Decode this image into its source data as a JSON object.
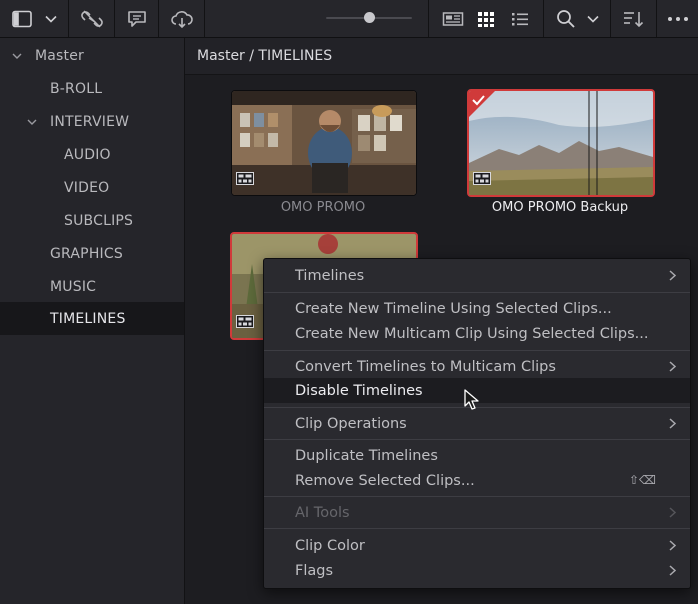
{
  "toolbar": {
    "icons": [
      "panel-layout-icon",
      "chevron-down-icon",
      "unlink-icon",
      "comment-icon",
      "cloud-icon",
      "zoom-slider",
      "metadata-view-icon",
      "grid-view-icon",
      "list-view-icon",
      "search-icon",
      "search-chevron-icon",
      "sort-icon",
      "more-icon"
    ],
    "zoom_level": 0.5
  },
  "sidebar": {
    "items": [
      {
        "label": "Master",
        "expanded": true
      },
      {
        "label": "B-ROLL"
      },
      {
        "label": "INTERVIEW",
        "expanded": true
      },
      {
        "label": "AUDIO"
      },
      {
        "label": "VIDEO"
      },
      {
        "label": "SUBCLIPS"
      },
      {
        "label": "GRAPHICS"
      },
      {
        "label": "MUSIC"
      },
      {
        "label": "TIMELINES",
        "selected": true
      }
    ]
  },
  "content": {
    "breadcrumb": "Master / TIMELINES",
    "clips": [
      {
        "name": "OMO PROMO",
        "selected": false
      },
      {
        "name": "OMO PROMO Backup",
        "selected": true,
        "checked": true
      },
      {
        "name": "",
        "selected": true
      }
    ]
  },
  "context_menu": {
    "items": [
      {
        "label": "Timelines",
        "submenu": true
      },
      {
        "label": "Create New Timeline Using Selected Clips..."
      },
      {
        "label": "Create New Multicam Clip Using Selected Clips..."
      },
      {
        "label": "Convert Timelines to Multicam Clips",
        "submenu": true
      },
      {
        "label": "Disable Timelines",
        "highlighted": true
      },
      {
        "label": "Clip Operations",
        "submenu": true
      },
      {
        "label": "Duplicate Timelines"
      },
      {
        "label": "Remove Selected Clips...",
        "shortcut": "⇧⌫"
      },
      {
        "label": "AI Tools",
        "submenu": true,
        "disabled": true
      },
      {
        "label": "Clip Color",
        "submenu": true
      },
      {
        "label": "Flags",
        "submenu": true
      }
    ]
  },
  "colors": {
    "selection_border": "#d03a3a",
    "menu_bg": "#2a2a2f",
    "highlight_bg": "#1c1c20"
  }
}
